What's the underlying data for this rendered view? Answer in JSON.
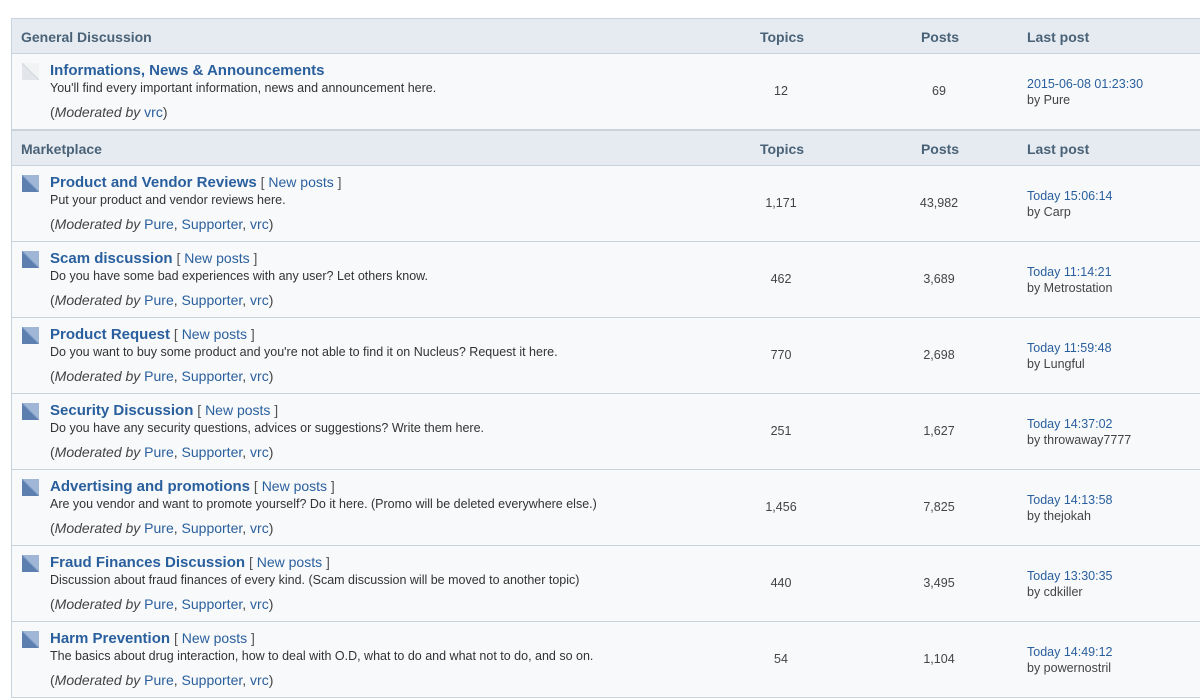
{
  "headers": {
    "topics": "Topics",
    "posts": "Posts",
    "last_post": "Last post"
  },
  "colors": {
    "link": "#2a5f9e",
    "header_bg": "#e5ebf0",
    "row_bg": "#f7f9fa",
    "border": "#c9d3dc"
  },
  "categories": [
    {
      "title": "General Discussion",
      "forums": [
        {
          "icon": "forum-read-icon",
          "title": "Informations, News & Announcements",
          "new_posts": "",
          "description": "You'll find every important information, news and announcement here.",
          "moderated_by_label": "Moderated by",
          "moderators": [
            "vrc"
          ],
          "topics": "12",
          "posts": "69",
          "last_post_time": "2015-06-08 01:23:30",
          "last_post_by": "by Pure"
        }
      ]
    },
    {
      "title": "Marketplace",
      "forums": [
        {
          "icon": "forum-new-posts-icon",
          "title": "Product and Vendor Reviews",
          "new_posts": "New posts",
          "description": "Put your product and vendor reviews here.",
          "moderated_by_label": "Moderated by",
          "moderators": [
            "Pure",
            "Supporter",
            "vrc"
          ],
          "topics": "1,171",
          "posts": "43,982",
          "last_post_time": "Today 15:06:14",
          "last_post_by": "by Carp"
        },
        {
          "icon": "forum-new-posts-icon",
          "title": "Scam discussion",
          "new_posts": "New posts",
          "description": "Do you have some bad experiences with any user? Let others know.",
          "moderated_by_label": "Moderated by",
          "moderators": [
            "Pure",
            "Supporter",
            "vrc"
          ],
          "topics": "462",
          "posts": "3,689",
          "last_post_time": "Today 11:14:21",
          "last_post_by": "by Metrostation"
        },
        {
          "icon": "forum-new-posts-icon",
          "title": "Product Request",
          "new_posts": "New posts",
          "description": "Do you want to buy some product and you're not able to find it on Nucleus? Request it here.",
          "moderated_by_label": "Moderated by",
          "moderators": [
            "Pure",
            "Supporter",
            "vrc"
          ],
          "topics": "770",
          "posts": "2,698",
          "last_post_time": "Today 11:59:48",
          "last_post_by": "by Lungful"
        },
        {
          "icon": "forum-new-posts-icon",
          "title": "Security Discussion",
          "new_posts": "New posts",
          "description": "Do you have any security questions, advices or suggestions? Write them here.",
          "moderated_by_label": "Moderated by",
          "moderators": [
            "Pure",
            "Supporter",
            "vrc"
          ],
          "topics": "251",
          "posts": "1,627",
          "last_post_time": "Today 14:37:02",
          "last_post_by": "by throwaway7777"
        },
        {
          "icon": "forum-new-posts-icon",
          "title": "Advertising and promotions",
          "new_posts": "New posts",
          "description": "Are you vendor and want to promote yourself? Do it here. (Promo will be deleted everywhere else.)",
          "moderated_by_label": "Moderated by",
          "moderators": [
            "Pure",
            "Supporter",
            "vrc"
          ],
          "topics": "1,456",
          "posts": "7,825",
          "last_post_time": "Today 14:13:58",
          "last_post_by": "by thejokah"
        },
        {
          "icon": "forum-new-posts-icon",
          "title": "Fraud Finances Discussion",
          "new_posts": "New posts",
          "description": "Discussion about fraud finances of every kind. (Scam discussion will be moved to another topic)",
          "moderated_by_label": "Moderated by",
          "moderators": [
            "Pure",
            "Supporter",
            "vrc"
          ],
          "topics": "440",
          "posts": "3,495",
          "last_post_time": "Today 13:30:35",
          "last_post_by": "by cdkiller"
        },
        {
          "icon": "forum-new-posts-icon",
          "title": "Harm Prevention",
          "new_posts": "New posts",
          "description": "The basics about drug interaction, how to deal with O.D, what to do and what not to do, and so on.",
          "moderated_by_label": "Moderated by",
          "moderators": [
            "Pure",
            "Supporter",
            "vrc"
          ],
          "topics": "54",
          "posts": "1,104",
          "last_post_time": "Today 14:49:12",
          "last_post_by": "by powernostril"
        }
      ]
    }
  ]
}
